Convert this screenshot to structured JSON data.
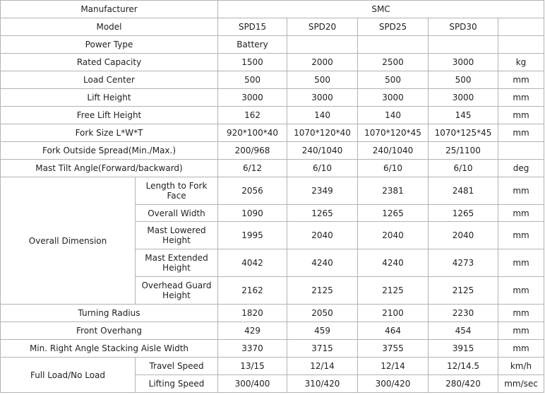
{
  "table": {
    "manufacturer_label": "Manufacturer",
    "manufacturer_value": "SMC",
    "model_label": "Model",
    "models": [
      "SPD15",
      "SPD20",
      "SPD25",
      "SPD30"
    ],
    "power_type_label": "Power Type",
    "power_type_value": "Battery",
    "rows_a": [
      {
        "label": "Rated Capacity",
        "values": [
          "1500",
          "2000",
          "2500",
          "3000"
        ],
        "unit": "kg"
      },
      {
        "label": "Load Center",
        "values": [
          "500",
          "500",
          "500",
          "500"
        ],
        "unit": "mm"
      },
      {
        "label": "Lift Height",
        "values": [
          "3000",
          "3000",
          "3000",
          "3000"
        ],
        "unit": "mm"
      },
      {
        "label": "Free Lift Height",
        "values": [
          "162",
          "140",
          "140",
          "145"
        ],
        "unit": "mm"
      },
      {
        "label": "Fork Size L*W*T",
        "values": [
          "920*100*40",
          "1070*120*40",
          "1070*120*45",
          "1070*125*45"
        ],
        "unit": "mm"
      },
      {
        "label": "Fork Outside Spread(Min./Max.)",
        "values": [
          "200/968",
          "240/1040",
          "240/1040",
          "25/1100"
        ],
        "unit": ""
      },
      {
        "label": "Mast Tilt Angle(Forward/backward)",
        "values": [
          "6/12",
          "6/10",
          "6/10",
          "6/10"
        ],
        "unit": "deg"
      }
    ],
    "overall_dimension": {
      "group_label": "Overall Dimension",
      "rows": [
        {
          "label": "Length to Fork Face",
          "values": [
            "2056",
            "2349",
            "2381",
            "2481"
          ],
          "unit": "mm"
        },
        {
          "label": "Overall Width",
          "values": [
            "1090",
            "1265",
            "1265",
            "1265"
          ],
          "unit": "mm"
        },
        {
          "label": "Mast Lowered Height",
          "values": [
            "1995",
            "2040",
            "2040",
            "2040"
          ],
          "unit": "mm"
        },
        {
          "label": "Mast Extended Height",
          "values": [
            "4042",
            "4240",
            "4240",
            "4273"
          ],
          "unit": "mm"
        },
        {
          "label": "Overhead Guard Height",
          "values": [
            "2162",
            "2125",
            "2125",
            "2125"
          ],
          "unit": "mm"
        }
      ]
    },
    "rows_b": [
      {
        "label": "Turning Radius",
        "values": [
          "1820",
          "2050",
          "2100",
          "2230"
        ],
        "unit": "mm"
      },
      {
        "label": "Front Overhang",
        "values": [
          "429",
          "459",
          "464",
          "454"
        ],
        "unit": "mm"
      },
      {
        "label": "Min. Right Angle Stacking Aisle Width",
        "values": [
          "3370",
          "3715",
          "3755",
          "3915"
        ],
        "unit": "mm"
      }
    ],
    "full_load": {
      "group_label": "Full Load/No Load",
      "rows": [
        {
          "label": "Travel Speed",
          "values": [
            "13/15",
            "12/14",
            "12/14",
            "12/14.5"
          ],
          "unit": "km/h"
        },
        {
          "label": "Lifting Speed",
          "values": [
            "300/400",
            "310/420",
            "300/420",
            "280/420"
          ],
          "unit": "mm/sec"
        }
      ]
    }
  }
}
